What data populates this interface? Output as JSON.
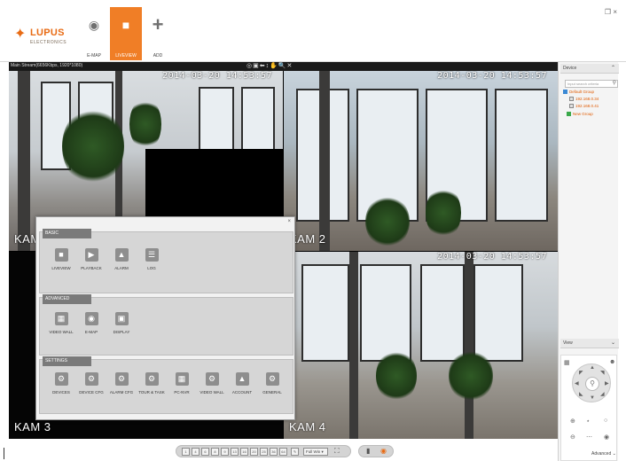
{
  "app": {
    "logo_text": "LUPUS",
    "logo_sub": "ELECTRONICS",
    "window_controls": "❐ ×"
  },
  "nav": {
    "emap_label": "E-MAP",
    "live_label": "LIVEVIEW",
    "add_label": "ADD"
  },
  "video": {
    "info_text": "Main Stream(6656Kbps, 1920*1080)",
    "tile_tools": "◎▣⬅↕✋🔍✕",
    "cameras": [
      {
        "label": "KAM 1",
        "timestamp": "2014-03-20 14:53:57"
      },
      {
        "label": "KAM 2",
        "timestamp": "2014-03-20 14:53:57"
      },
      {
        "label": "KAM 3",
        "timestamp": ""
      },
      {
        "label": "KAM 4",
        "timestamp": "2014-03-20 14:53:57"
      }
    ]
  },
  "device_panel": {
    "title": "Device",
    "search_placeholder": "Input search criteria",
    "tree": {
      "root": "Default Group",
      "items": [
        "192.168.0.34",
        "192.168.0.41"
      ],
      "new_group": "New Group"
    }
  },
  "view_panel": {
    "title": "View",
    "advanced_label": "Advanced"
  },
  "bottom": {
    "layout_buttons": [
      "1",
      "4",
      "6",
      "8",
      "9",
      "13",
      "16",
      "20",
      "25",
      "36",
      "64"
    ],
    "layout_select": "Full Win",
    "fullscreen_icon": "⛶"
  },
  "popup": {
    "close": "×",
    "sections": [
      {
        "title": "BASIC",
        "items": [
          {
            "label": "LIVEVIEW",
            "icon": "camera-icon"
          },
          {
            "label": "PLAYBACK",
            "icon": "playback-icon"
          },
          {
            "label": "ALARM",
            "icon": "alarm-icon"
          },
          {
            "label": "LOG",
            "icon": "log-icon"
          }
        ]
      },
      {
        "title": "ADVANCED",
        "items": [
          {
            "label": "VIDEO WALL",
            "icon": "video-wall-icon"
          },
          {
            "label": "E-MAP",
            "icon": "map-icon"
          },
          {
            "label": "DISPLAY",
            "icon": "display-icon"
          }
        ]
      },
      {
        "title": "SETTINGS",
        "items": [
          {
            "label": "DEVICES",
            "icon": "devices-icon"
          },
          {
            "label": "DEVICE CFG",
            "icon": "device-cfg-icon"
          },
          {
            "label": "ALARM CFG",
            "icon": "alarm-cfg-icon"
          },
          {
            "label": "TOUR & TASK",
            "icon": "tour-task-icon"
          },
          {
            "label": "PC-NVR",
            "icon": "pc-nvr-icon"
          },
          {
            "label": "VIDEO WALL",
            "icon": "video-wall-icon"
          },
          {
            "label": "ACCOUNT",
            "icon": "account-icon"
          },
          {
            "label": "GENERAL",
            "icon": "general-icon"
          }
        ]
      }
    ]
  }
}
